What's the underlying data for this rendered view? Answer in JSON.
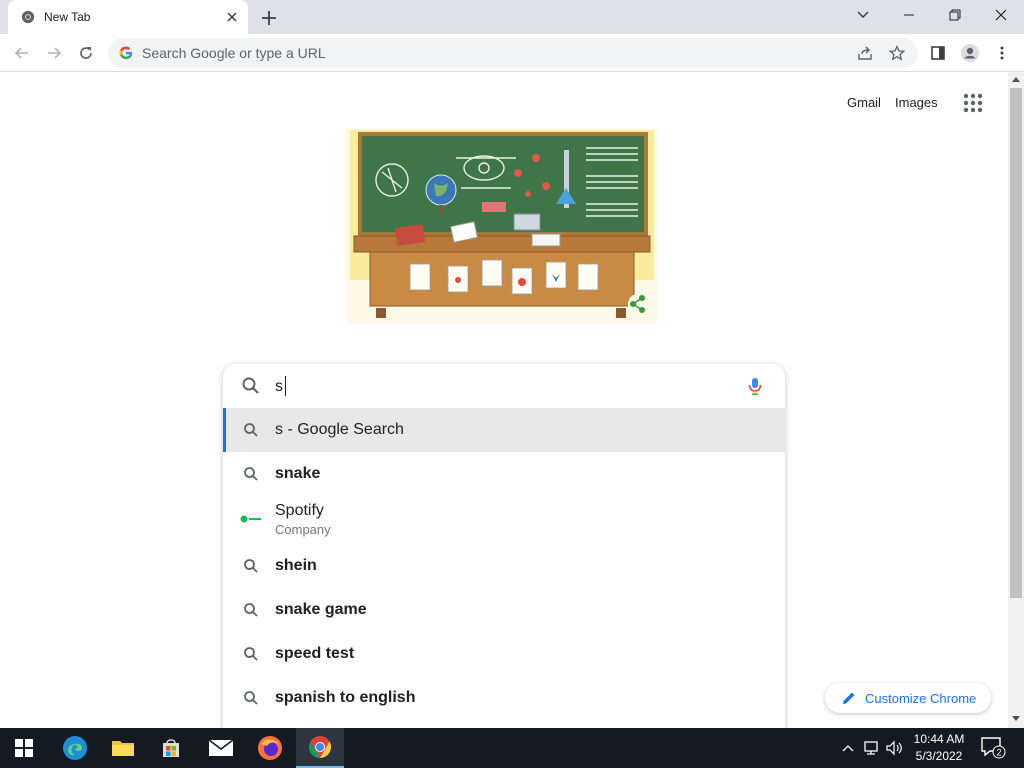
{
  "window": {
    "tab_title": "New Tab",
    "omnibox_placeholder": "Search Google or type a URL"
  },
  "header": {
    "gmail": "Gmail",
    "images": "Images"
  },
  "search": {
    "query": "s",
    "suggestions": [
      {
        "text": "s - Google Search",
        "icon": "search-icon"
      },
      {
        "text": "snake",
        "icon": "search-icon"
      },
      {
        "text": "Spotify",
        "sub": "Company",
        "icon": "spotify-logo-icon"
      },
      {
        "text": "shein",
        "icon": "search-icon"
      },
      {
        "text": "snake game",
        "icon": "search-icon"
      },
      {
        "text": "speed test",
        "icon": "search-icon"
      },
      {
        "text": "spanish to english",
        "icon": "search-icon"
      }
    ]
  },
  "customize": {
    "label": "Customize Chrome"
  },
  "taskbar": {
    "time": "10:44 AM",
    "date": "5/3/2022",
    "notification_count": "2"
  },
  "colors": {
    "accent": "#1a73e8",
    "tab_strip": "#dee1e6",
    "taskbar": "#131a22"
  }
}
